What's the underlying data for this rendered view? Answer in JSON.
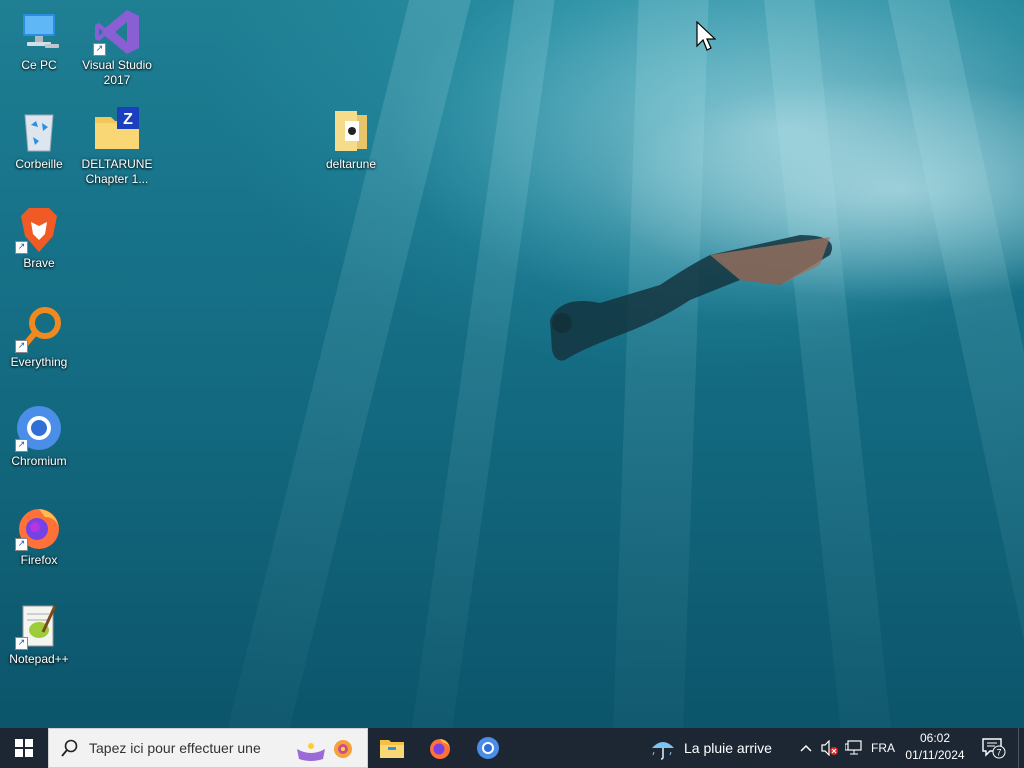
{
  "desktop": {
    "icons": [
      {
        "label": "Ce PC"
      },
      {
        "label": "Visual Studio 2017"
      },
      {
        "label": "Corbeille"
      },
      {
        "label": "DELTARUNE Chapter 1..."
      },
      {
        "label": "deltarune"
      },
      {
        "label": "Brave"
      },
      {
        "label": "Everything"
      },
      {
        "label": "Chromium"
      },
      {
        "label": "Firefox"
      },
      {
        "label": "Notepad++"
      }
    ]
  },
  "taskbar": {
    "search_placeholder": "Tapez ici pour effectuer une",
    "weather_text": "La pluie arrive",
    "language": "FRA",
    "time": "06:02",
    "date": "01/11/2024",
    "notification_count": "7"
  },
  "colors": {
    "taskbar_bg": "#1c2733",
    "wallpaper_top": "#1f7f93",
    "wallpaper_bottom": "#0c556b",
    "accent": "#0078d7"
  }
}
